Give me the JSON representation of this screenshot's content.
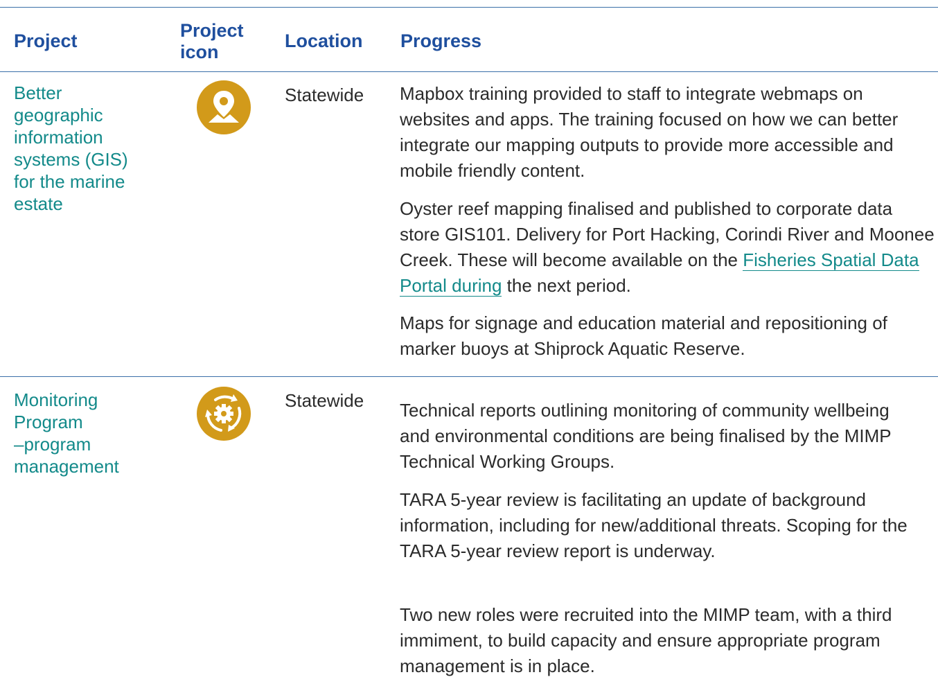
{
  "table": {
    "headers": {
      "project": "Project",
      "icon_line1": "Project",
      "icon_line2": "icon",
      "location": "Location",
      "progress": "Progress"
    },
    "rows": [
      {
        "project_lines": [
          "Better",
          "geographic",
          "information",
          "systems (GIS)",
          "for the marine",
          "estate"
        ],
        "icon": "map-pin-icon",
        "location": "Statewide",
        "progress": {
          "p1": "Mapbox training provided to staff to integrate webmaps on websites and apps. The training focused on how we can better integrate our mapping outputs to provide more accessible and mobile friendly content.",
          "p2_before": "Oyster reef mapping finalised and published to corporate data store GIS101. Delivery for Port Hacking, Corindi River and Moonee Creek. These will become available on the ",
          "p2_link": "Fisheries Spatial Data Portal during",
          "p2_after": " the next period.",
          "p3": "Maps for signage and education material and repositioning of marker buoys at Shiprock Aquatic Reserve."
        }
      },
      {
        "project_lines": [
          "Monitoring",
          "Program",
          "–program",
          "management"
        ],
        "icon": "cycle-gear-icon",
        "location": "Statewide",
        "progress": {
          "p1": "Technical reports outlining monitoring of community wellbeing and environmental conditions are being finalised by the MIMP Technical Working Groups.",
          "p2": "TARA 5-year review is facilitating an update of background information, including for new/additional threats. Scoping for the TARA 5-year review report is underway.",
          "p3": "Two new roles were recruited into the MIMP team, with a third immiment, to build capacity and ensure appropriate program management is in place."
        }
      }
    ]
  },
  "colors": {
    "header_text": "#1f4f9e",
    "project_text": "#138a8a",
    "icon_fill": "#d29a1a",
    "rule": "#3a6fa8"
  }
}
